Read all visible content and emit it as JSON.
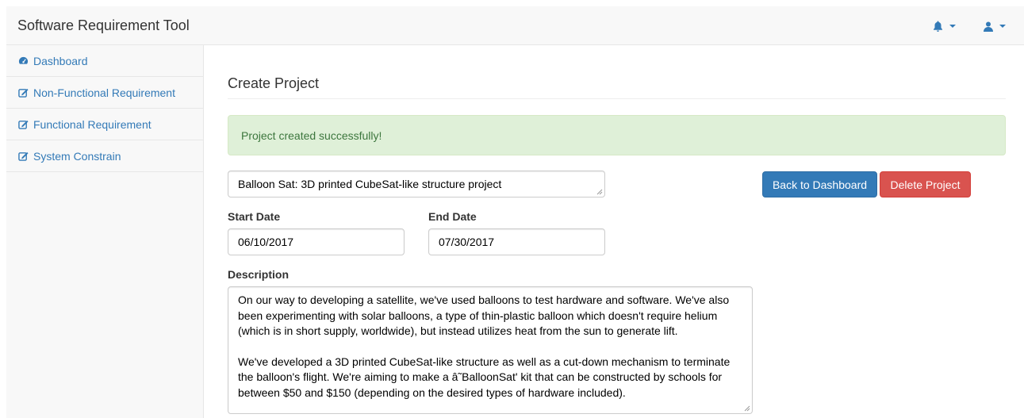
{
  "app": {
    "title": "Software Requirement Tool"
  },
  "header": {
    "notifications_icon": "bell-icon",
    "user_icon": "user-icon",
    "accent_color": "#337ab7"
  },
  "sidebar": {
    "items": [
      {
        "label": "Dashboard",
        "icon": "dashboard-icon"
      },
      {
        "label": "Non-Functional Requirement",
        "icon": "edit-icon"
      },
      {
        "label": "Functional Requirement",
        "icon": "edit-icon"
      },
      {
        "label": "System Constrain",
        "icon": "edit-icon"
      }
    ]
  },
  "main": {
    "title": "Create Project",
    "alert": {
      "text": "Project created successfully!",
      "color": "#3c763d",
      "background": "#dff0d8"
    },
    "project_name": "Balloon Sat: 3D printed CubeSat-like structure project",
    "buttons": {
      "back": "Back to Dashboard",
      "delete": "Delete Project"
    },
    "start_date": {
      "label": "Start Date",
      "value": "06/10/2017"
    },
    "end_date": {
      "label": "End Date",
      "value": "07/30/2017"
    },
    "description": {
      "label": "Description",
      "paragraph1": "On our way to developing a satellite, we've used balloons to test hardware and software. We've also been experimenting with solar balloons, a type of thin-plastic balloon which doesn't require helium (which is in short supply, worldwide), but instead utilizes heat from the sun to generate lift.",
      "paragraph2": "We've developed a 3D printed CubeSat-like structure as well as a cut-down mechanism to terminate the balloon's flight. We're aiming to make a â˜BalloonSat' kit that can be constructed by schools for between $50 and $150 (depending on the desired types of hardware included)."
    }
  }
}
